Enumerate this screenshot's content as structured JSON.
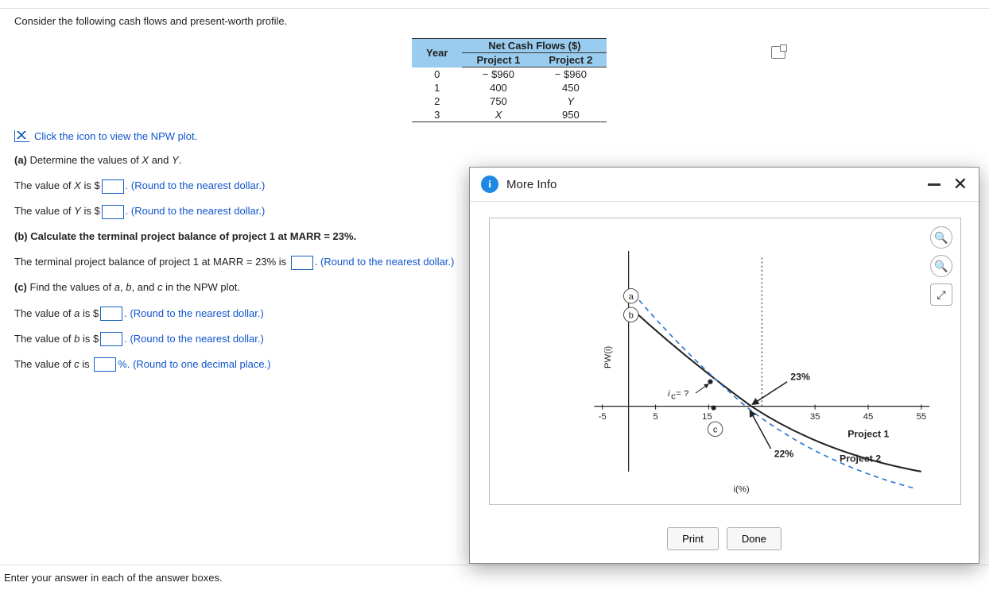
{
  "intro": "Consider the following cash flows and present-worth profile.",
  "table": {
    "superheader": "Net Cash Flows ($)",
    "cols": {
      "year": "Year",
      "p1": "Project 1",
      "p2": "Project 2"
    },
    "rows": [
      {
        "year": "0",
        "p1": "− $960",
        "p2": "− $960"
      },
      {
        "year": "1",
        "p1": "400",
        "p2": "450"
      },
      {
        "year": "2",
        "p1": "750",
        "p2": "Y"
      },
      {
        "year": "3",
        "p1": "X",
        "p2": "950"
      }
    ]
  },
  "npw_link": "Click the icon to view the NPW plot.",
  "parts": {
    "a": {
      "prompt": "(a) Determine the values of X and Y.",
      "x_pre": "The value of X is $",
      "x_hint": ". (Round to the nearest dollar.)",
      "y_pre": "The value of Y is $",
      "y_hint": ". (Round to the nearest dollar.)"
    },
    "b": {
      "prompt": "(b) Calculate the terminal project balance of project 1 at MARR = 23%.",
      "line_pre": "The terminal project balance of project 1 at MARR = 23% is ",
      "hint": " (Round to the nearest dollar.)"
    },
    "c": {
      "prompt": "(c) Find the values of a, b, and c in the NPW plot.",
      "a_pre": "The value of a is $",
      "a_hint": ". (Round to the nearest dollar.)",
      "b_pre": "The value of b is $",
      "b_hint": ". (Round to the nearest dollar.)",
      "c_pre": "The value of c is ",
      "c_suf": "%. (Round to one decimal place.)"
    }
  },
  "footer": "Enter your answer in each of the answer boxes.",
  "modal": {
    "title": "More Info",
    "print": "Print",
    "done": "Done"
  },
  "chart_data": {
    "type": "line",
    "xlabel": "i(%)",
    "ylabel": "PW(i)",
    "x_ticks": [
      -5,
      5,
      15,
      35,
      45,
      55
    ],
    "annotations": {
      "a_label": "a",
      "b_label": "b",
      "c_label": "c",
      "ic_label": "i_c = ?",
      "p1_root_pct": "23%",
      "p2_root_pct": "22%"
    },
    "series": [
      {
        "name": "Project 1",
        "style": "solid",
        "x_intercept": 23
      },
      {
        "name": "Project 2",
        "style": "dashed",
        "x_intercept": 22
      }
    ],
    "vertical_guide_at": 25
  }
}
